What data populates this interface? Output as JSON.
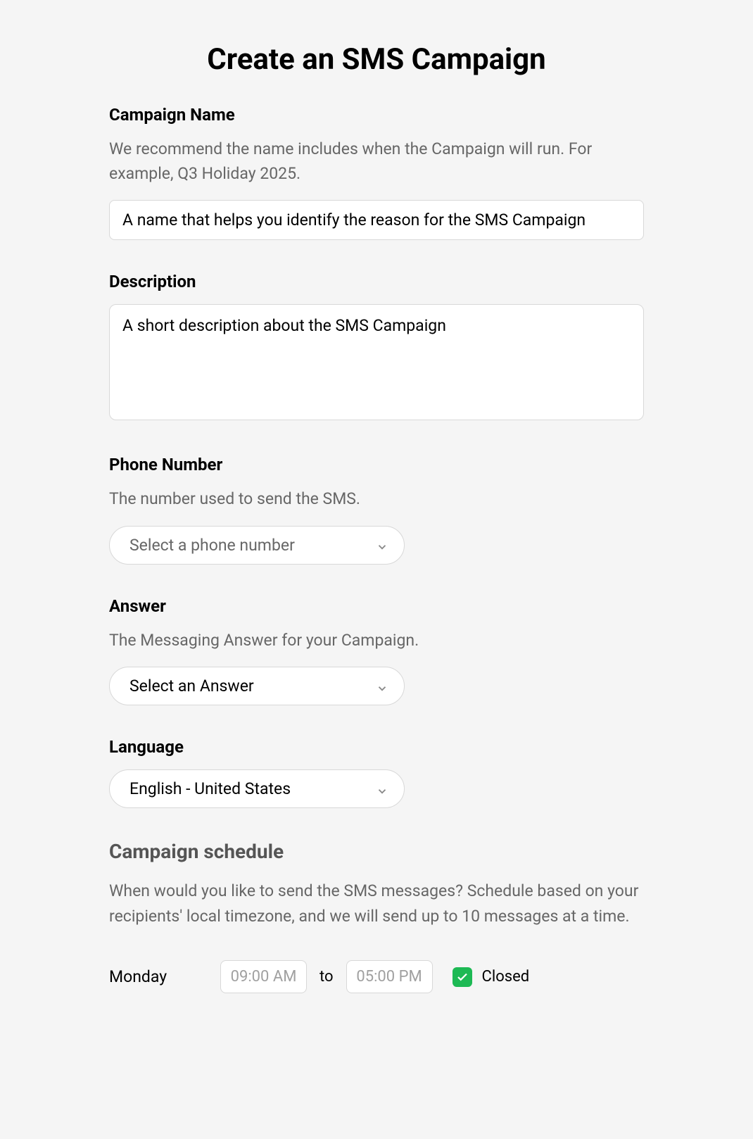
{
  "title": "Create an SMS Campaign",
  "campaignName": {
    "label": "Campaign Name",
    "hint": "We recommend the name includes when the Campaign will run. For example, Q3 Holiday 2025.",
    "placeholder": "A name that helps you identify the reason for the SMS Campaign"
  },
  "description": {
    "label": "Description",
    "placeholder": "A short description about the SMS Campaign"
  },
  "phoneNumber": {
    "label": "Phone Number",
    "hint": "The number used to send the SMS.",
    "placeholder": "Select a phone number"
  },
  "answer": {
    "label": "Answer",
    "hint": "The Messaging Answer for your Campaign.",
    "placeholder": "Select an Answer"
  },
  "language": {
    "label": "Language",
    "value": "English - United States"
  },
  "schedule": {
    "heading": "Campaign schedule",
    "description": "When would you like to send the SMS messages? Schedule based on your recipients' local timezone, and we will send up to 10 messages at a time.",
    "row": {
      "day": "Monday",
      "from": "09:00 AM",
      "to_label": "to",
      "to": "05:00 PM",
      "closed_label": "Closed",
      "closed_checked": true
    }
  }
}
